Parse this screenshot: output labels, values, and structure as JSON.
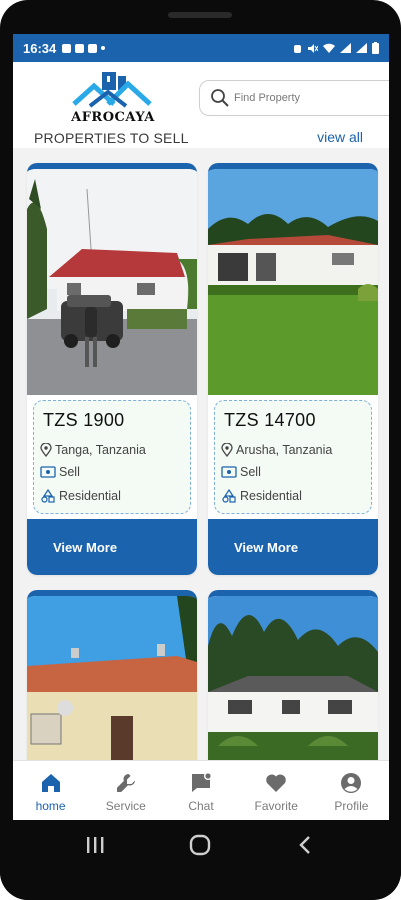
{
  "status_bar": {
    "time": "16:34"
  },
  "header": {
    "logo_text": "AFROCAYA",
    "search_placeholder": "Find Property"
  },
  "section": {
    "title": "PROPERTIES TO SELL",
    "view_all": "view all"
  },
  "listings": [
    {
      "price": "TZS 1900",
      "location": "Tanga, Tanzania",
      "purpose": "Sell",
      "category": "Residential",
      "button": "View More"
    },
    {
      "price": "TZS 14700",
      "location": "Arusha, Tanzania",
      "purpose": "Sell",
      "category": "Residential",
      "button": "View More"
    }
  ],
  "bottom_nav": [
    {
      "label": "home",
      "icon": "home-icon",
      "active": true
    },
    {
      "label": "Service",
      "icon": "wrench-icon",
      "active": false
    },
    {
      "label": "Chat",
      "icon": "chat-icon",
      "active": false
    },
    {
      "label": "Favorite",
      "icon": "heart-icon",
      "active": false
    },
    {
      "label": "Profile",
      "icon": "profile-icon",
      "active": false
    }
  ],
  "colors": {
    "brand_blue": "#1b63ad",
    "info_box_bg": "#f4faf4",
    "info_box_border": "#7fb0db"
  }
}
